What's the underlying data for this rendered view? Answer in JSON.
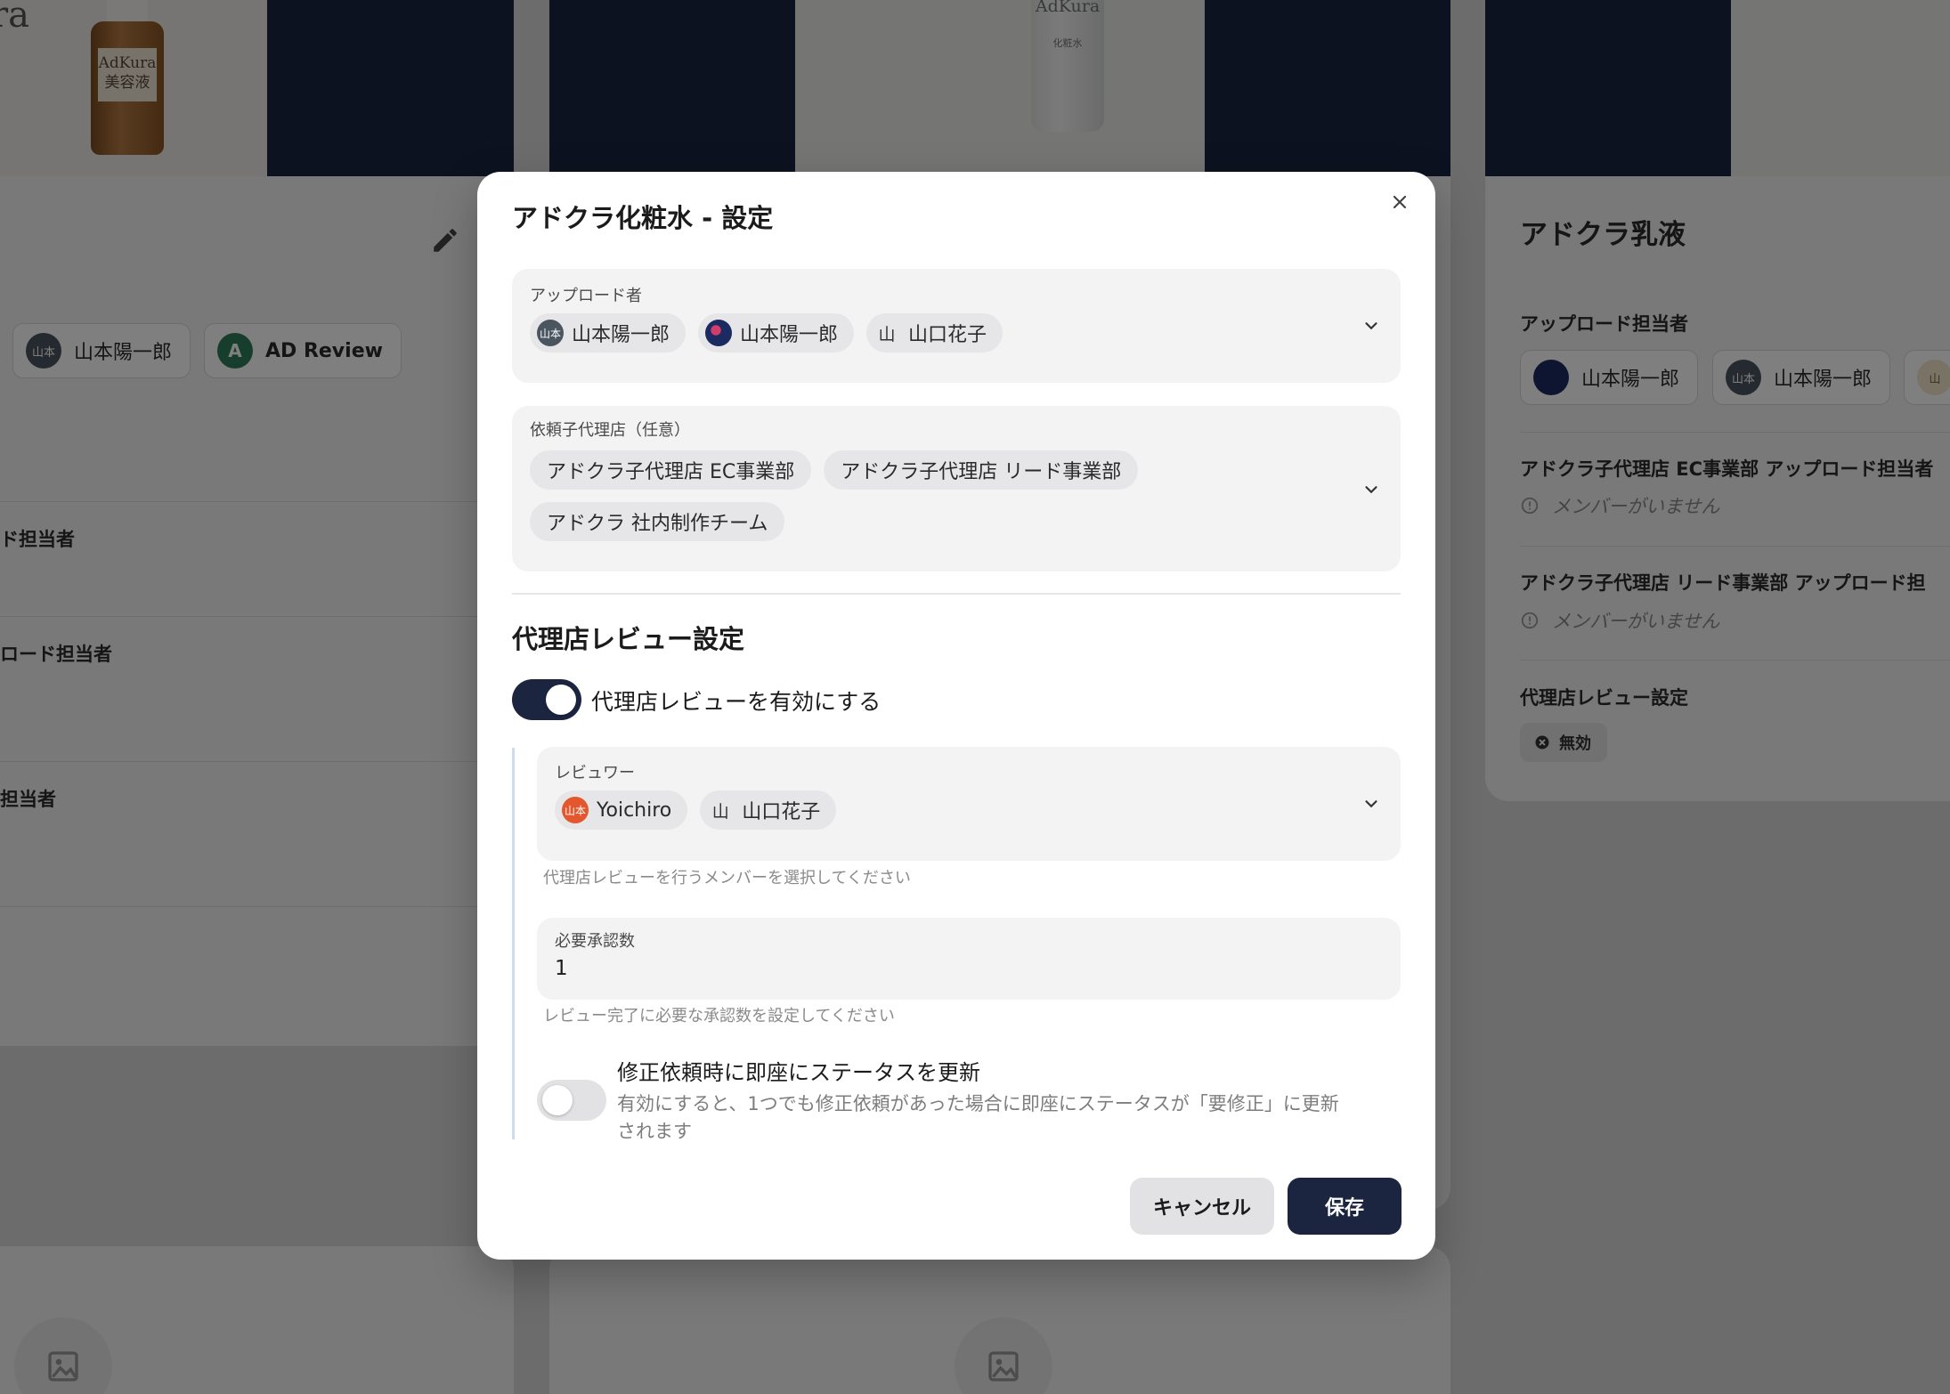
{
  "background": {
    "left_card": {
      "bottle_brand": "AdKura",
      "bottle_product": "美容液",
      "chip_user": "山本陽一郎",
      "chip_user_avatar": "山本",
      "chip_ad_review": "AD Review",
      "chip_ad_review_avatar": "A",
      "label1": "ド担当者",
      "label2": "ロード担当者",
      "label3": "担当者",
      "partial_logo": "ra"
    },
    "mid_card": {
      "tube_brand": "AdKura",
      "tube_sub": "化粧水"
    },
    "right_card": {
      "title": "アドクラ乳液",
      "uploader_section": "アップロード担当者",
      "chip_user_1": "山本陽一郎",
      "chip_user_2": "山本陽一郎",
      "chip_user_2_avatar": "山本",
      "chip_user_3_avatar": "山",
      "ec_section": "アドクラ子代理店 EC事業部 アップロード担当者",
      "ec_empty": "メンバーがいません",
      "lead_section": "アドクラ子代理店 リード事業部 アップロード担",
      "lead_empty": "メンバーがいません",
      "review_section": "代理店レビュー設定",
      "review_status": "無効"
    }
  },
  "modal": {
    "title": "アドクラ化粧水 - 設定",
    "uploader": {
      "label": "アップロード者",
      "chips": [
        {
          "avatar": "山本",
          "name": "山本陽一郎",
          "avatar_color": "#4a5560"
        },
        {
          "avatar": "",
          "name": "山本陽一郎",
          "avatar_color": "#1b2a60"
        },
        {
          "avatar": "山",
          "name": "山口花子",
          "avatar_color": "#e2e2e4"
        }
      ]
    },
    "agencies": {
      "label": "依頼子代理店（任意）",
      "chips": [
        "アドクラ子代理店 EC事業部",
        "アドクラ子代理店 リード事業部",
        "アドクラ 社内制作チーム"
      ]
    },
    "review_section_title": "代理店レビュー設定",
    "enable_review": {
      "label": "代理店レビューを有効にする",
      "enabled": true
    },
    "reviewers": {
      "label": "レビュワー",
      "chips": [
        {
          "avatar": "山本",
          "name": "Yoichiro",
          "avatar_color": "#e4572e"
        },
        {
          "avatar": "山",
          "name": "山口花子",
          "avatar_color": "#e2e2e4"
        }
      ],
      "helper": "代理店レビューを行うメンバーを選択してください"
    },
    "required_approvals": {
      "label": "必要承認数",
      "value": "1",
      "helper": "レビュー完了に必要な承認数を設定してください"
    },
    "instant_status": {
      "title": "修正依頼時に即座にステータスを更新",
      "description_line1": "有効にすると、1つでも修正依頼があった場合に即座にステータスが「要修正」に更新",
      "description_line2": "されます",
      "enabled": false
    },
    "buttons": {
      "cancel": "キャンセル",
      "save": "保存"
    }
  },
  "colors": {
    "primary": "#1b2540",
    "field_bg": "#f3f3f4",
    "chip_bg": "#e6e6e8",
    "helper_text": "#8a8a8a",
    "sub_border": "#cfdcee"
  }
}
